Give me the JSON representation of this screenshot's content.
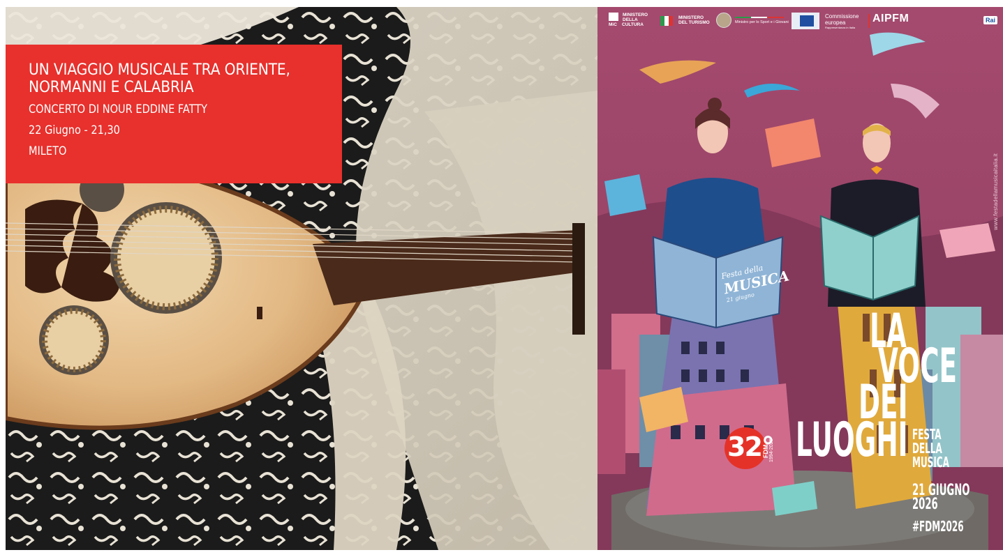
{
  "event": {
    "title_line1": "UN VIAGGIO MUSICALE TRA ORIENTE,",
    "title_line2": "NORMANNI E CALABRIA",
    "concert": "CONCERTO DI NOUR EDDINE FATTY",
    "date_time": "22 Giugno - 21,30",
    "place": "MILETO"
  },
  "poster": {
    "sponsors": {
      "mic_line1": "MINISTERO",
      "mic_line2": "DELLA",
      "mic_big": "CULTURA",
      "mic_abbr": "MiC",
      "turismo_line1": "MINISTERO",
      "turismo_line2": "DEL TURISMO",
      "sport": "Ministro per lo Sport e i Giovani",
      "ec_line1": "Commissione",
      "ec_line2": "europea",
      "ec_line3": "Rappresentanza in Italia",
      "aipfm": "AIPFM",
      "rai": "Rai"
    },
    "url": "www.festadellamusicaitalia.it",
    "title_la": "LA",
    "title_voce": "VOCE",
    "title_dei": "DEI",
    "title_luoghi": "LUOGHI",
    "festa1": "FESTA",
    "festa2": "DELLA",
    "festa3": "MUSICA",
    "date1": "21 GIUGNO",
    "date2": "2026",
    "hashtag": "#FDM2026",
    "badge_num": "32°",
    "badge_fdm": "FDM",
    "badge_years": "1994-2026",
    "songbook_text1": "Festa della",
    "songbook_text2": "MUSICA",
    "songbook_text3": "21 giugno"
  },
  "colors": {
    "red": "#e8302c",
    "poster_bg": "#a04a70",
    "badge_red": "#e53228"
  }
}
